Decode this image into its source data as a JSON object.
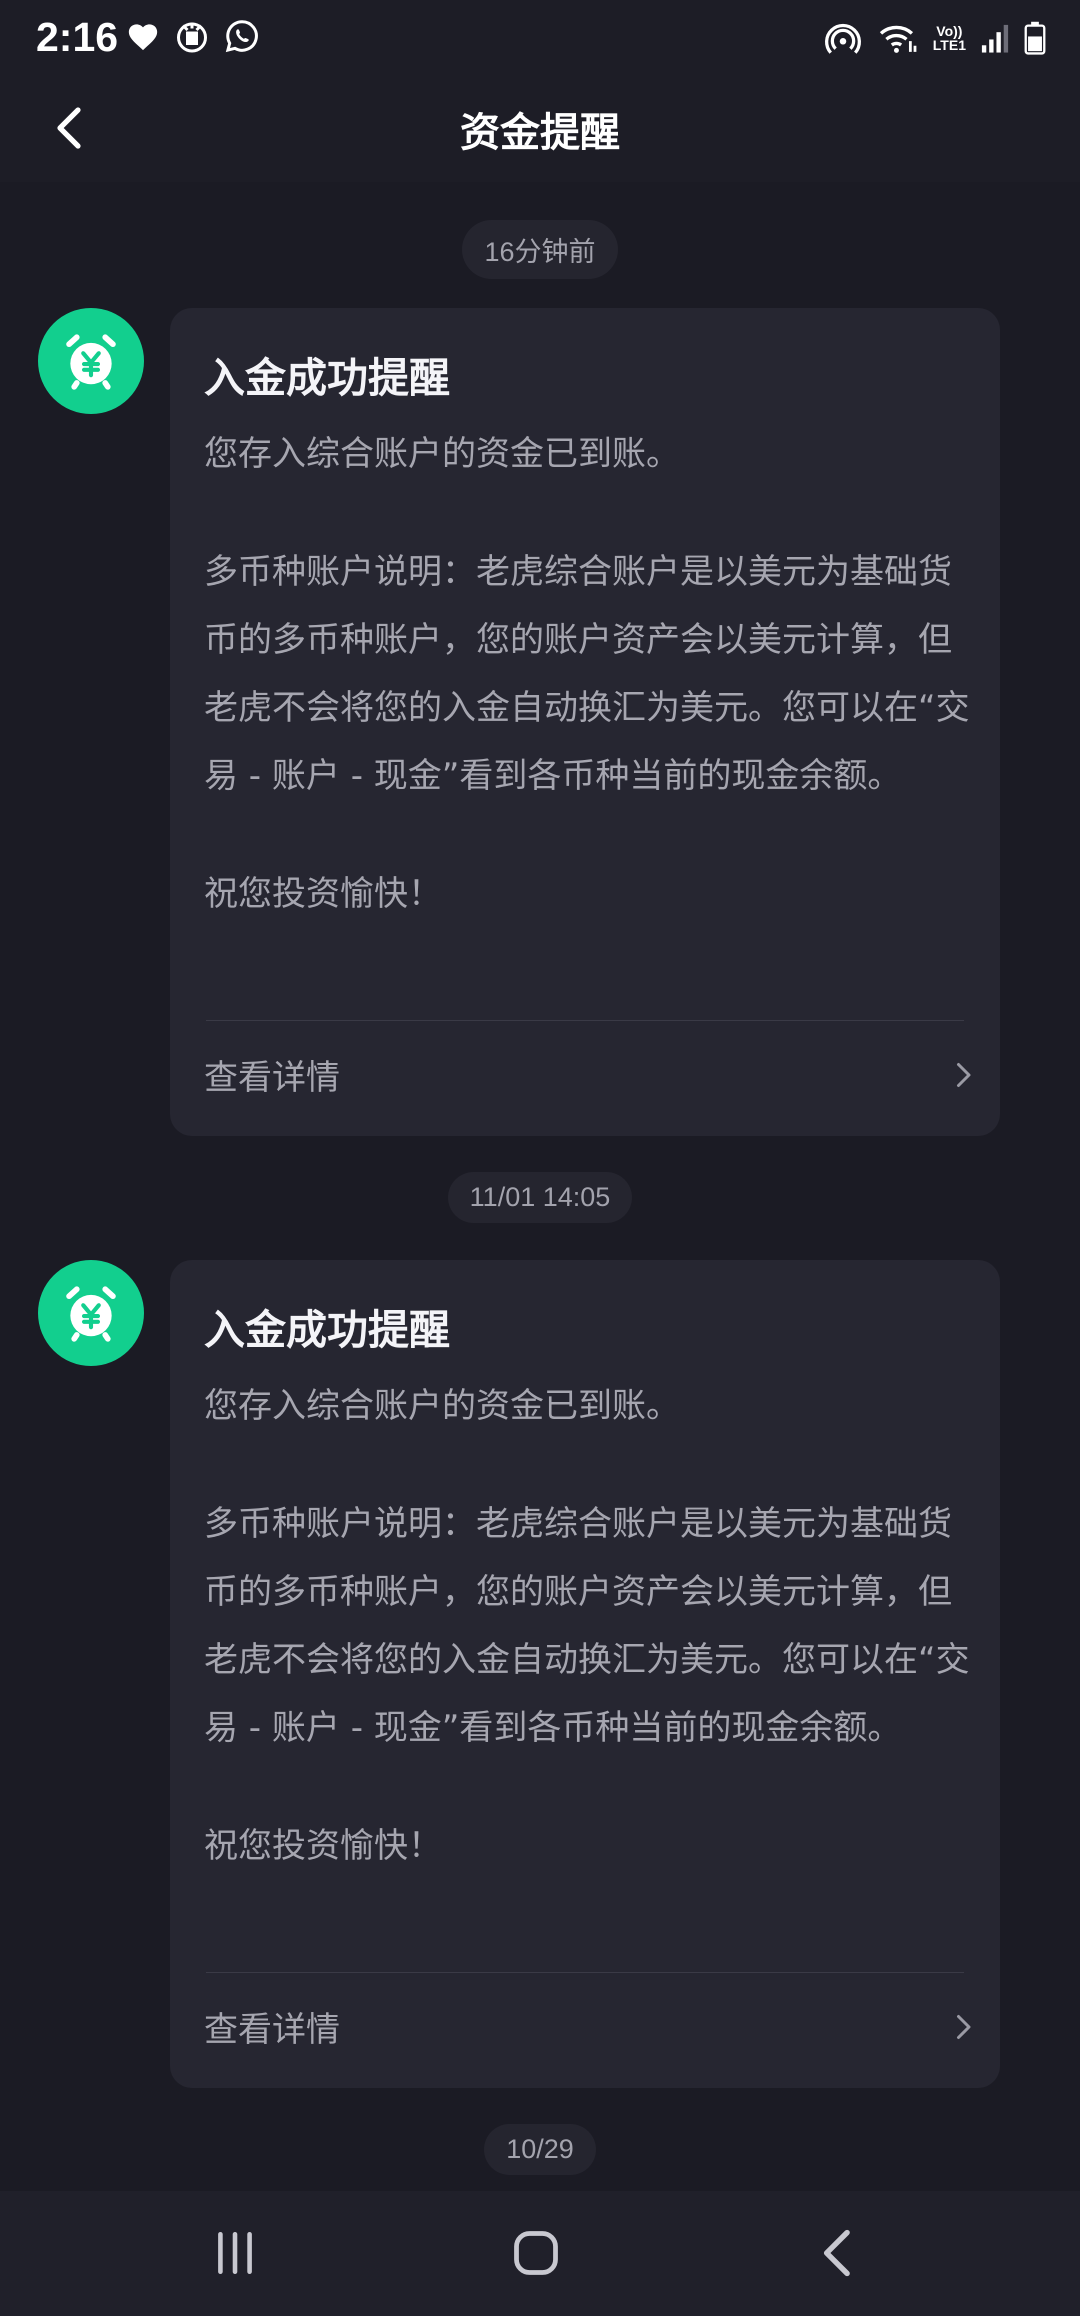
{
  "status_bar": {
    "time": "2:16",
    "left_icons": [
      "heart-icon",
      "gift-badge-icon",
      "whatsapp-icon"
    ],
    "right_icons": [
      "hotspot-icon",
      "wifi-icon",
      "volte-icon",
      "signal-icon",
      "battery-icon"
    ],
    "volte_line1": "Vo))",
    "volte_line2": "LTE1"
  },
  "header": {
    "title": "资金提醒",
    "back_icon": "chevron-left-icon"
  },
  "messages": [
    {
      "timestamp": "16分钟前",
      "avatar_icon": "alarm-clock-yen-icon",
      "title": "入金成功提醒",
      "line1": "您存入综合账户的资金已到账。",
      "paragraph2": "多币种账户说明：老虎综合账户是以美元为基础货币的多币种账户，您的账户资产会以美元计算，但老虎不会将您的入金自动换汇为美元。您可以在“交易 - 账户 - 现金”看到各币种当前的现金余额。",
      "closing": "祝您投资愉快！",
      "link_label": "查看详情"
    },
    {
      "timestamp": "11/01 14:05",
      "avatar_icon": "alarm-clock-yen-icon",
      "title": "入金成功提醒",
      "line1": "您存入综合账户的资金已到账。",
      "paragraph2": "多币种账户说明：老虎综合账户是以美元为基础货币的多币种账户，您的账户资产会以美元计算，但老虎不会将您的入金自动换汇为美元。您可以在“交易 - 账户 - 现金”看到各币种当前的现金余额。",
      "closing": "祝您投资愉快！",
      "link_label": "查看详情"
    }
  ],
  "next_timestamp": "10/29",
  "system_nav": {
    "recents_icon": "recents-icon",
    "home_icon": "home-icon",
    "back_icon": "back-icon"
  },
  "colors": {
    "accent": "#12cf8e",
    "background": "#1b1b24",
    "card": "#262631"
  }
}
